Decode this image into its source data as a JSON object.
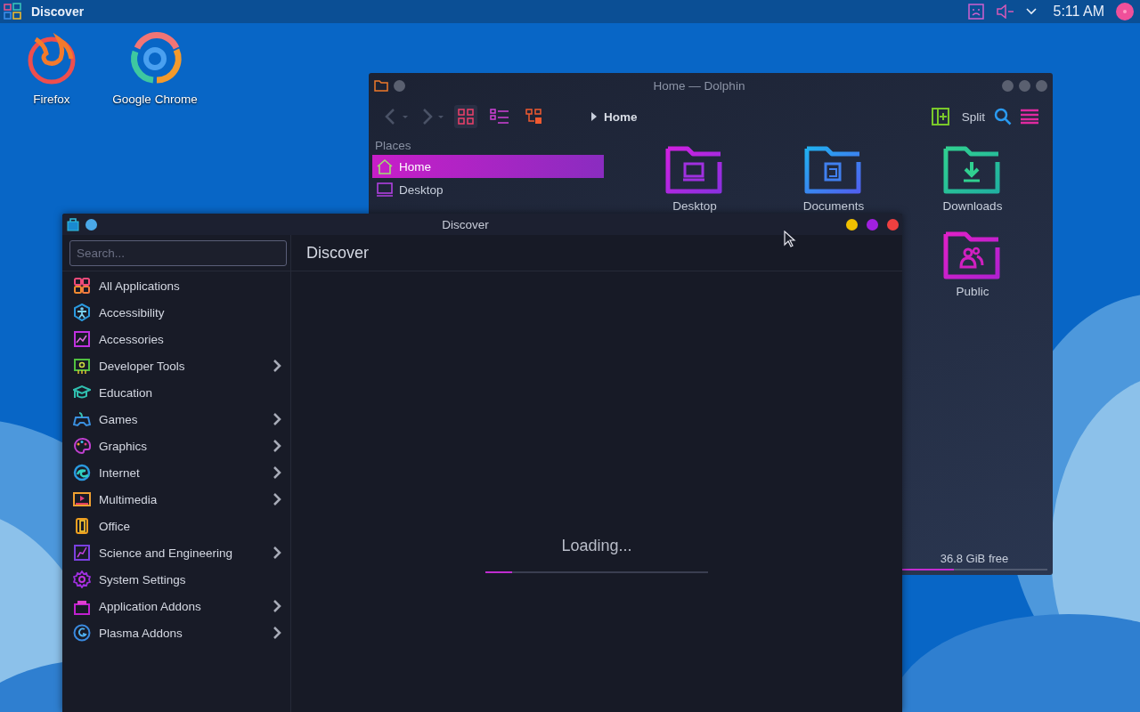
{
  "panel": {
    "app_title": "Discover",
    "clock": "5:11 AM"
  },
  "desktop_icons": [
    {
      "label": "Firefox"
    },
    {
      "label": "Google Chrome"
    }
  ],
  "dolphin": {
    "title": "Home — Dolphin",
    "view_modes": [
      {
        "selected": true
      },
      {
        "selected": false
      },
      {
        "selected": false
      }
    ],
    "breadcrumb": "Home",
    "split_label": "Split",
    "places_header": "Places",
    "places": [
      {
        "label": "Home",
        "selected": true
      },
      {
        "label": "Desktop",
        "selected": false
      }
    ],
    "folders": [
      {
        "label": "Desktop"
      },
      {
        "label": "Documents"
      },
      {
        "label": "Downloads"
      },
      {
        "label": "Public"
      }
    ],
    "free_space": "36.8 GiB free",
    "disk_usage": {
      "level": 0.36
    }
  },
  "discover": {
    "title": "Discover",
    "search": {
      "placeholder": "Search..."
    },
    "heading": "Discover",
    "categories": [
      {
        "label": "All Applications",
        "expandable": false
      },
      {
        "label": "Accessibility",
        "expandable": false
      },
      {
        "label": "Accessories",
        "expandable": false
      },
      {
        "label": "Developer Tools",
        "expandable": true
      },
      {
        "label": "Education",
        "expandable": false
      },
      {
        "label": "Games",
        "expandable": true
      },
      {
        "label": "Graphics",
        "expandable": true
      },
      {
        "label": "Internet",
        "expandable": true
      },
      {
        "label": "Multimedia",
        "expandable": true
      },
      {
        "label": "Office",
        "expandable": false
      },
      {
        "label": "Science and Engineering",
        "expandable": true
      },
      {
        "label": "System Settings",
        "expandable": false
      },
      {
        "label": "Application Addons",
        "expandable": true
      },
      {
        "label": "Plasma Addons",
        "expandable": true
      }
    ],
    "loading": {
      "text": "Loading...",
      "level": 0.12
    }
  }
}
